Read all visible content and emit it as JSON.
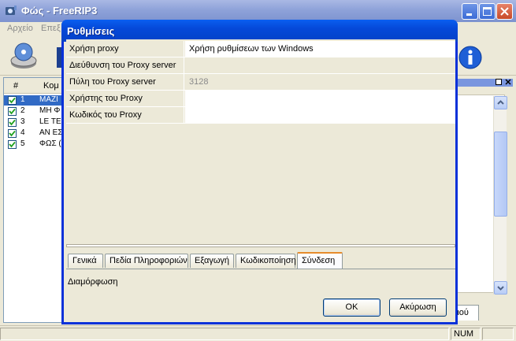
{
  "main_window": {
    "title": "Φώς - FreeRIP3",
    "menu": [
      "Αρχείο",
      "Επεξ"
    ],
    "track_header": {
      "num": "#",
      "title": "Κομ"
    },
    "tracks": [
      {
        "num": "1",
        "title": "ΜΑΖΙ",
        "checked": true,
        "selected": true
      },
      {
        "num": "2",
        "title": "ΜΗ Φ",
        "checked": true,
        "selected": false
      },
      {
        "num": "3",
        "title": "LE TE",
        "checked": true,
        "selected": false
      },
      {
        "num": "4",
        "title": "ΑΝ ΕΣ",
        "checked": true,
        "selected": false
      },
      {
        "num": "5",
        "title": "ΦΩΣ (",
        "checked": true,
        "selected": false
      }
    ],
    "right_tab": "τιού",
    "status": {
      "num": "NUM"
    },
    "colors": {
      "title_bar": "#8ea2d9",
      "selection": "#316ac5",
      "info_icon": "#1f5fd6"
    }
  },
  "dialog": {
    "title": "Ρυθμίσεις",
    "properties": [
      {
        "label": "Χρήση proxy",
        "value": "Χρήση ρυθμίσεων των Windows",
        "style": "white"
      },
      {
        "label": "Διεύθυνση του Proxy server",
        "value": "",
        "style": "none"
      },
      {
        "label": "Πύλη του Proxy server",
        "value": "3128",
        "style": "grey"
      },
      {
        "label": "Χρήστης του Proxy",
        "value": "",
        "style": "white"
      },
      {
        "label": "Κωδικός του Proxy",
        "value": "",
        "style": "white"
      }
    ],
    "tabs": [
      {
        "label": "Γενικά",
        "active": false
      },
      {
        "label": "Πεδία Πληροφοριών",
        "active": false
      },
      {
        "label": "Εξαγωγή",
        "active": false
      },
      {
        "label": "Κωδικοποίηση",
        "active": false
      },
      {
        "label": "Σύνδεση",
        "active": true
      }
    ],
    "description": "Διαμόρφωση",
    "ok_label": "OK",
    "cancel_label": "Ακύρωση",
    "colors": {
      "title_bar": "#0548d8",
      "active_tab_accent": "#e68b2c"
    }
  }
}
